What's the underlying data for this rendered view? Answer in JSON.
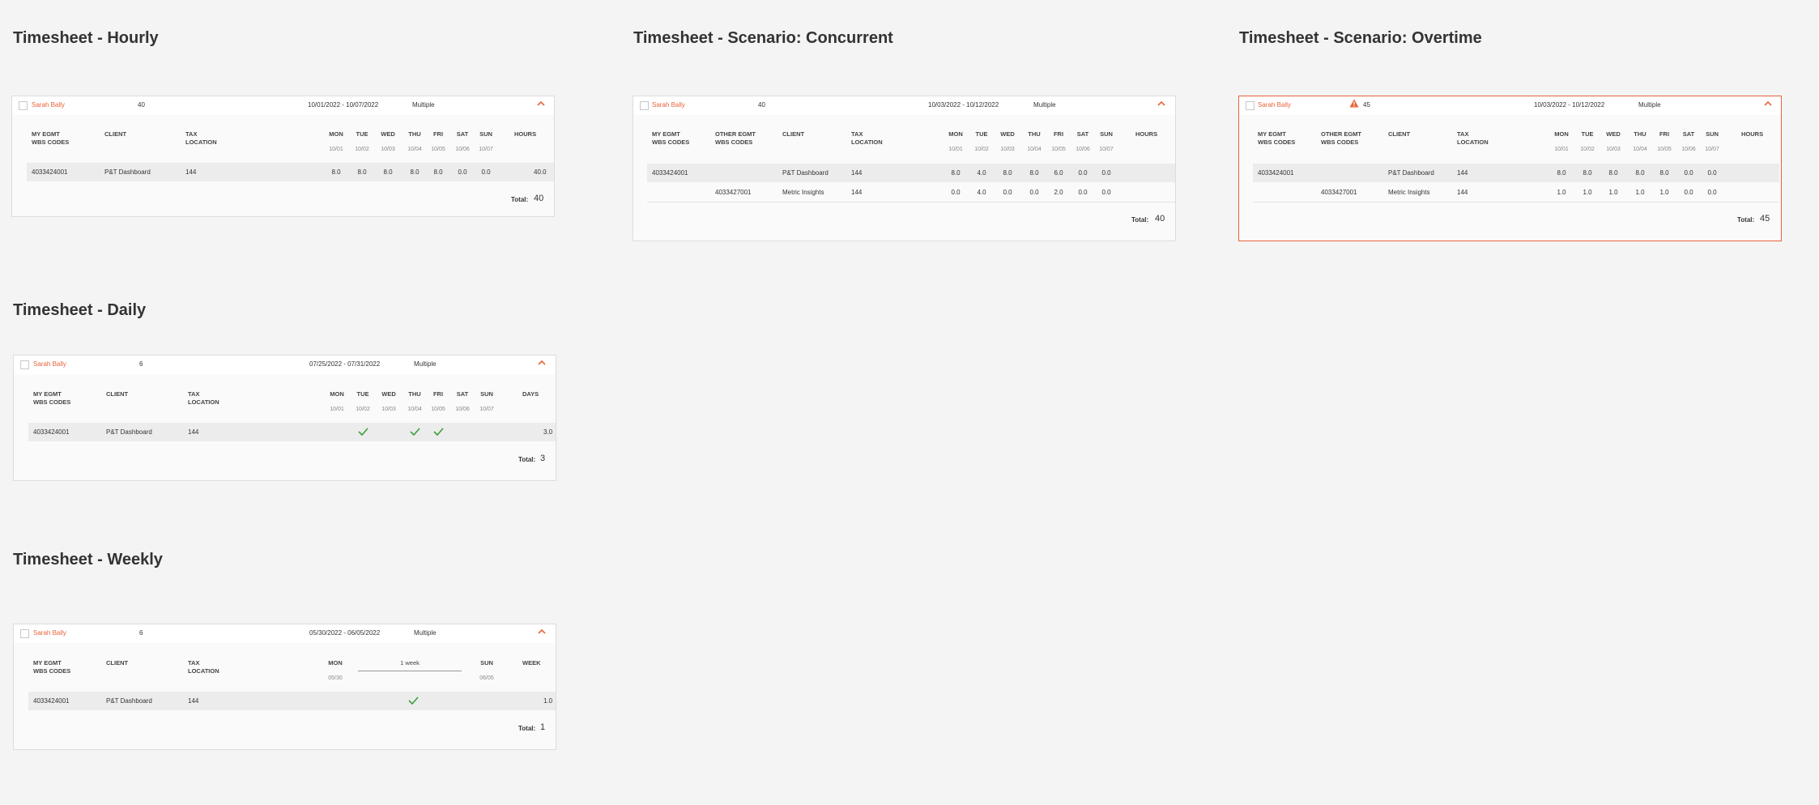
{
  "titles": {
    "hourly": "Timesheet - Hourly",
    "concurrent": "Timesheet - Scenario: Concurrent",
    "overtime": "Timesheet - Scenario: Overtime",
    "daily": "Timesheet - Daily",
    "weekly": "Timesheet - Weekly"
  },
  "colors": {
    "accent": "#e8633a",
    "check": "#3ba03b",
    "row_shade": "#ececec"
  },
  "icons": {
    "collapse": "chevron-up-icon",
    "warning": "warning-triangle-icon",
    "day_check": "check-icon",
    "select": "checkbox-icon"
  },
  "hourly": {
    "employee": "Sarah Bally",
    "count": "40",
    "range": "10/01/2022 - 10/07/2022",
    "location": "Multiple",
    "headers": {
      "wbs1": "MY EGMT",
      "wbs2": "WBS CODES",
      "client": "CLIENT",
      "tax1": "TAX",
      "tax2": "LOCATION",
      "hours": "HOURS"
    },
    "days": [
      "MON",
      "TUE",
      "WED",
      "THU",
      "FRI",
      "SAT",
      "SUN"
    ],
    "dates": [
      "10/01",
      "10/02",
      "10/03",
      "10/04",
      "10/05",
      "10/06",
      "10/07"
    ],
    "row": {
      "wbs": "4033424001",
      "client": "P&T Dashboard",
      "tax": "144",
      "values": [
        "8.0",
        "8.0",
        "8.0",
        "8.0",
        "8.0",
        "0.0",
        "0.0"
      ],
      "hours": "40.0"
    },
    "total_label": "Total:",
    "total": "40"
  },
  "concurrent": {
    "employee": "Sarah Bally",
    "count": "40",
    "range": "10/03/2022 - 10/12/2022",
    "location": "Multiple",
    "headers": {
      "wbs1": "MY EGMT",
      "wbs2": "WBS CODES",
      "other1": "OTHER EGMT",
      "other2": "WBS CODES",
      "client": "CLIENT",
      "tax1": "TAX",
      "tax2": "LOCATION",
      "hours": "HOURS"
    },
    "days": [
      "MON",
      "TUE",
      "WED",
      "THU",
      "FRI",
      "SAT",
      "SUN"
    ],
    "dates": [
      "10/01",
      "10/02",
      "10/03",
      "10/04",
      "10/05",
      "10/06",
      "10/07"
    ],
    "rows": [
      {
        "wbs": "4033424001",
        "other": "",
        "client": "P&T Dashboard",
        "tax": "144",
        "values": [
          "8.0",
          "4.0",
          "8.0",
          "8.0",
          "6.0",
          "0.0",
          "0.0"
        ]
      },
      {
        "wbs": "",
        "other": "4033427001",
        "client": "Metric Insights",
        "tax": "144",
        "values": [
          "0.0",
          "4.0",
          "0.0",
          "0.0",
          "2.0",
          "0.0",
          "0.0"
        ]
      }
    ],
    "total_label": "Total:",
    "total": "40"
  },
  "overtime": {
    "employee": "Sarah Bally",
    "count": "45",
    "range": "10/03/2022 - 10/12/2022",
    "location": "Multiple",
    "headers": {
      "wbs1": "MY EGMT",
      "wbs2": "WBS CODES",
      "other1": "OTHER EGMT",
      "other2": "WBS CODES",
      "client": "CLIENT",
      "tax1": "TAX",
      "tax2": "LOCATION",
      "hours": "HOURS"
    },
    "days": [
      "MON",
      "TUE",
      "WED",
      "THU",
      "FRI",
      "SAT",
      "SUN"
    ],
    "dates": [
      "10/01",
      "10/02",
      "10/03",
      "10/04",
      "10/05",
      "10/06",
      "10/07"
    ],
    "rows": [
      {
        "wbs": "4033424001",
        "other": "",
        "client": "P&T Dashboard",
        "tax": "144",
        "values": [
          "8.0",
          "8.0",
          "8.0",
          "8.0",
          "8.0",
          "0.0",
          "0.0"
        ]
      },
      {
        "wbs": "",
        "other": "4033427001",
        "client": "Metric Insights",
        "tax": "144",
        "values": [
          "1.0",
          "1.0",
          "1.0",
          "1.0",
          "1.0",
          "0.0",
          "0.0"
        ]
      }
    ],
    "total_label": "Total:",
    "total": "45"
  },
  "daily": {
    "employee": "Sarah Bally",
    "count": "6",
    "range": "07/25/2022 - 07/31/2022",
    "location": "Multiple",
    "headers": {
      "wbs1": "MY EGMT",
      "wbs2": "WBS CODES",
      "client": "CLIENT",
      "tax1": "TAX",
      "tax2": "LOCATION",
      "days": "DAYS"
    },
    "days": [
      "MON",
      "TUE",
      "WED",
      "THU",
      "FRI",
      "SAT",
      "SUN"
    ],
    "dates": [
      "10/01",
      "10/02",
      "10/03",
      "10/04",
      "10/05",
      "10/06",
      "10/07"
    ],
    "row": {
      "wbs": "4033424001",
      "client": "P&T Dashboard",
      "tax": "144",
      "checked": [
        false,
        true,
        false,
        true,
        true,
        false,
        false
      ],
      "days": "3.0"
    },
    "total_label": "Total:",
    "total": "3"
  },
  "weekly": {
    "employee": "Sarah Bally",
    "count": "6",
    "range": "05/30/2022 - 06/05/2022",
    "location": "Multiple",
    "headers": {
      "wbs1": "MY EGMT",
      "wbs2": "WBS CODES",
      "client": "CLIENT",
      "tax1": "TAX",
      "tax2": "LOCATION",
      "mon": "MON",
      "span": "1 week",
      "sun": "SUN",
      "week": "WEEK"
    },
    "dates": {
      "mon": "05/30",
      "sun": "06/05"
    },
    "row": {
      "wbs": "4033424001",
      "client": "P&T Dashboard",
      "tax": "144",
      "checked": true,
      "week": "1.0"
    },
    "total_label": "Total:",
    "total": "1"
  }
}
